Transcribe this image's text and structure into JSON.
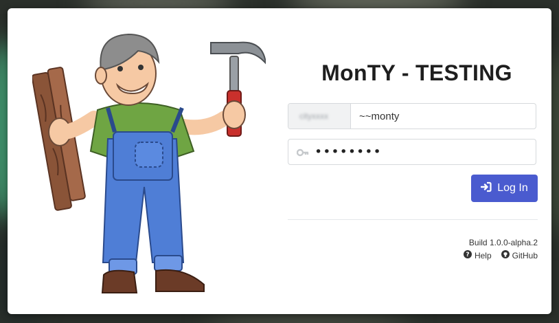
{
  "app": {
    "title": "MonTY - TESTING"
  },
  "login": {
    "username_prefix": "cityxxxx",
    "username_value": "~~monty",
    "password_value": "••••••••",
    "button_label": "Log In",
    "button_color": "#4a5bcf"
  },
  "footer": {
    "build": "Build 1.0.0-alpha.2",
    "help_label": "Help",
    "github_label": "GitHub"
  },
  "icons": {
    "login": "sign-in-icon",
    "password": "key-icon",
    "help": "question-circle-icon",
    "github": "github-icon"
  }
}
